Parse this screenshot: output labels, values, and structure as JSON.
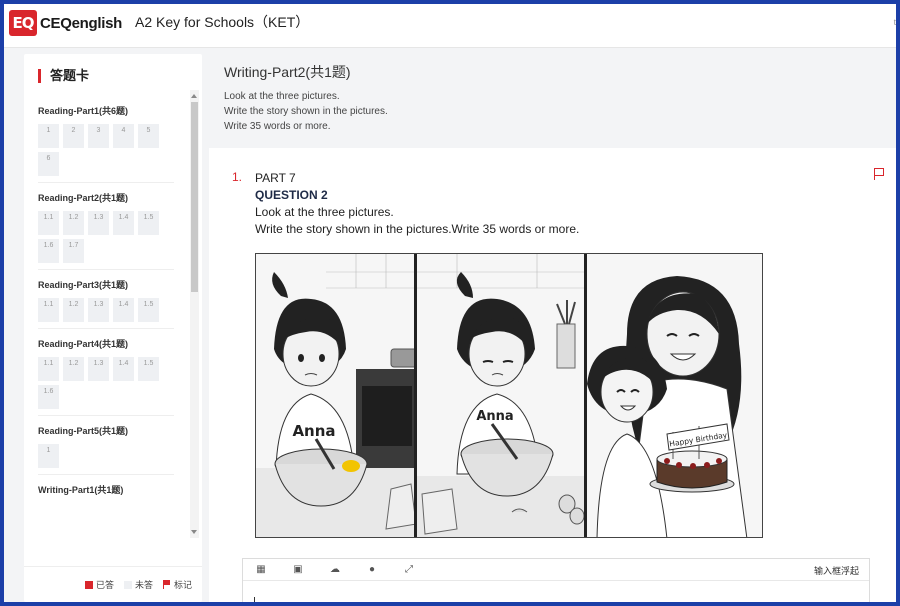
{
  "header": {
    "logo_mark": "EQ",
    "logo_text": "CEQenglish",
    "title": "A2 Key for Schools（KET）",
    "edge_text": "t"
  },
  "sidebar": {
    "title": "答题卡",
    "sections": [
      {
        "title": "Reading-Part1(共6题)",
        "cells": [
          "1",
          "2",
          "3",
          "4",
          "5",
          "6"
        ]
      },
      {
        "title": "Reading-Part2(共1题)",
        "cells": [
          "1.1",
          "1.2",
          "1.3",
          "1.4",
          "1.5",
          "1.6",
          "1.7"
        ]
      },
      {
        "title": "Reading-Part3(共1题)",
        "cells": [
          "1.1",
          "1.2",
          "1.3",
          "1.4",
          "1.5"
        ]
      },
      {
        "title": "Reading-Part4(共1题)",
        "cells": [
          "1.1",
          "1.2",
          "1.3",
          "1.4",
          "1.5",
          "1.6"
        ]
      },
      {
        "title": "Reading-Part5(共1题)",
        "cells": [
          "1"
        ]
      },
      {
        "title": "Writing-Part1(共1题)",
        "cells": []
      }
    ],
    "legend": {
      "answered": "已答",
      "unanswered": "未答",
      "marked": "标记"
    },
    "colors": {
      "answered": "#d9262c",
      "unanswered": "#eef0f3",
      "marked": "#d9262c"
    }
  },
  "main": {
    "section_title": "Writing-Part2(共1题)",
    "instructions": [
      "Look at the three pictures.",
      "Write the story shown in the pictures.",
      "Write 35 words or more."
    ],
    "question": {
      "number": "1.",
      "part": "PART 7",
      "label": "QUESTION 2",
      "line1": "Look at the three pictures.",
      "line2": "Write the story shown in the pictures.Write 35 words or more."
    },
    "pictures": {
      "shirt_name": "Anna",
      "cake_banner": "Happy Birthday"
    },
    "editor": {
      "tools": [
        "table-icon",
        "image-icon",
        "cloud-upload-icon",
        "microphone-icon",
        "fullscreen-icon"
      ],
      "float_label": "输入框浮起"
    }
  }
}
